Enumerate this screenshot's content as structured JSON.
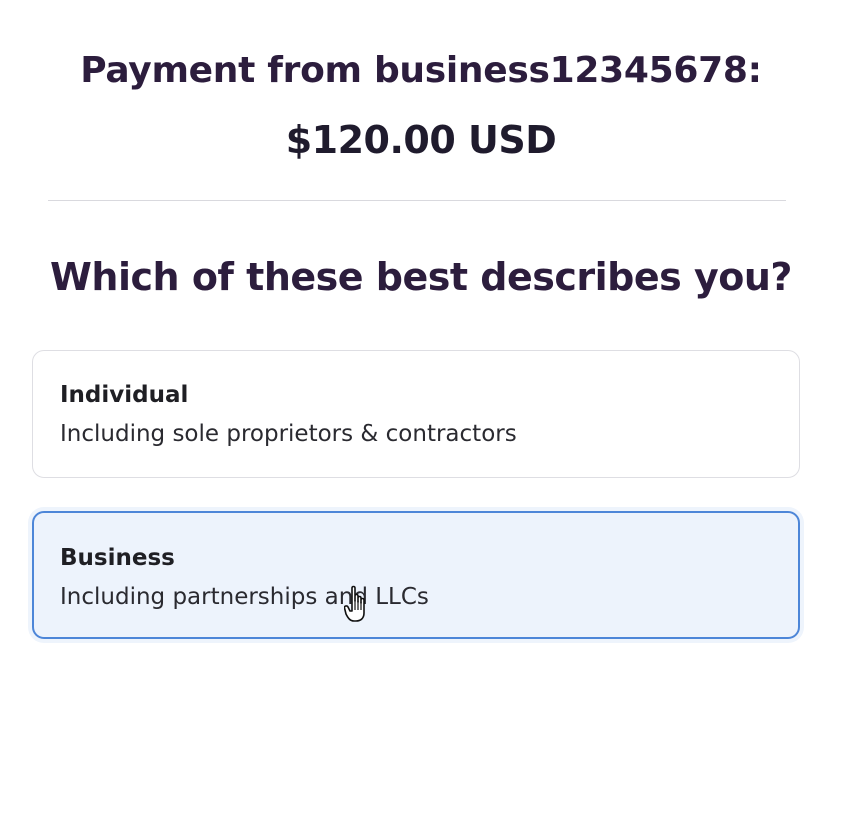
{
  "header": {
    "payment_from": "Payment from business12345678:",
    "amount": "$120.00 USD"
  },
  "question": "Which of these best describes you?",
  "options": [
    {
      "title": "Individual",
      "description": "Including sole proprietors & contractors",
      "selected": false
    },
    {
      "title": "Business",
      "description": "Including partnerships and LLCs",
      "selected": true
    }
  ],
  "colors": {
    "heading": "#2c1d3d",
    "selected_border": "#4d86d8",
    "selected_background": "#edf3fc",
    "divider": "#d9d9de"
  },
  "cursor": {
    "icon": "hand-pointer-icon"
  }
}
